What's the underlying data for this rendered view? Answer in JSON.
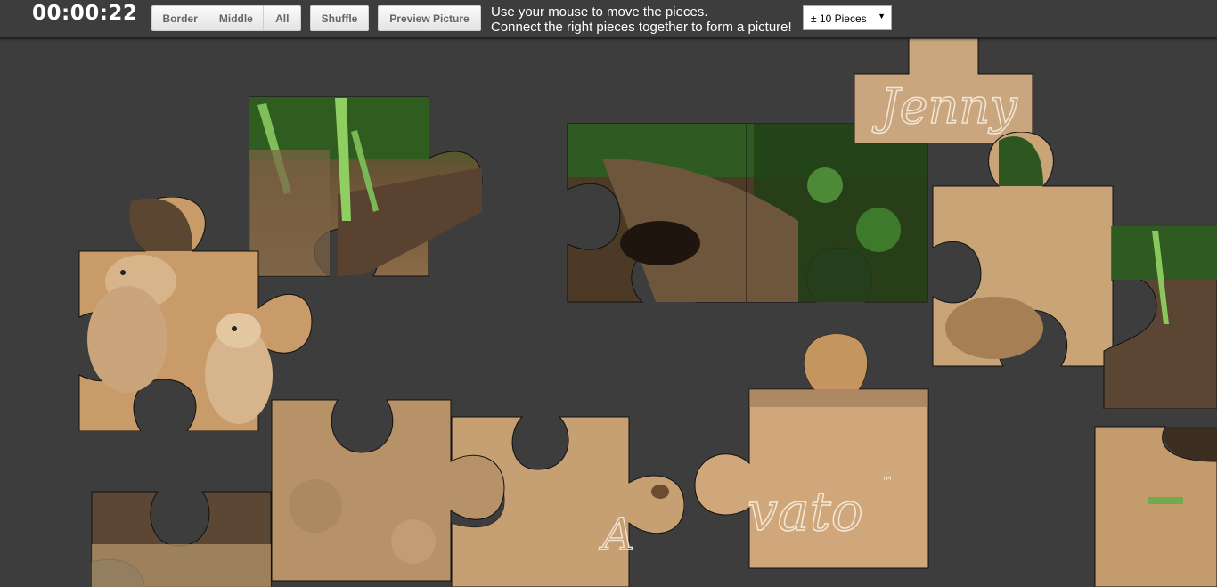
{
  "timer": "00:00:22",
  "buttons": {
    "border": "Border",
    "middle": "Middle",
    "all": "All",
    "shuffle": "Shuffle",
    "preview": "Preview Picture"
  },
  "instructions": {
    "line1": "Use your mouse to move the pieces.",
    "line2": "Connect the right pieces together to form a picture!"
  },
  "piece_count": {
    "selected": "± 10 Pieces"
  },
  "colors": {
    "background": "#3d3d3d",
    "sand": "#c9a37a",
    "sand_dark": "#a8825a",
    "log": "#5a4632",
    "foliage": "#2f5a22",
    "meerkat": "#d8b88c"
  }
}
